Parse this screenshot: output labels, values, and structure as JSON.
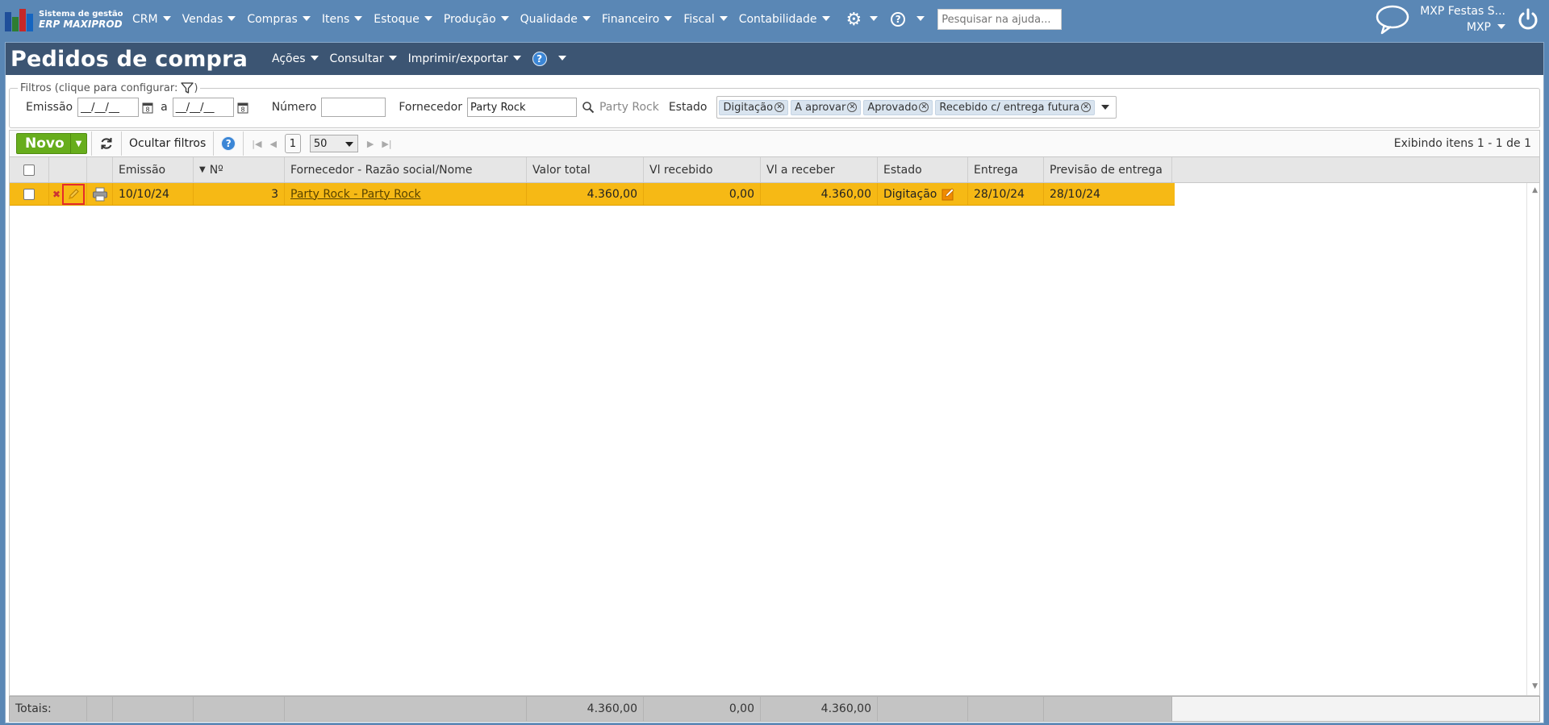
{
  "brand": {
    "line1": "Sistema de gestão",
    "line2": "ERP MAXIPROD"
  },
  "menu": [
    {
      "label": "CRM"
    },
    {
      "label": "Vendas"
    },
    {
      "label": "Compras"
    },
    {
      "label": "Itens"
    },
    {
      "label": "Estoque"
    },
    {
      "label": "Produção"
    },
    {
      "label": "Qualidade"
    },
    {
      "label": "Financeiro"
    },
    {
      "label": "Fiscal"
    },
    {
      "label": "Contabilidade"
    }
  ],
  "help_search": {
    "placeholder": "Pesquisar na ajuda..."
  },
  "user": {
    "company": "MXP Festas S...",
    "account": "MXP"
  },
  "page": {
    "title": "Pedidos de compra",
    "actions": [
      "Ações",
      "Consultar",
      "Imprimir/exportar"
    ]
  },
  "filters": {
    "legend": "Filtros (clique para configurar:",
    "legend_close": ")",
    "emissao_label": "Emissão",
    "date_from": "__/__/__",
    "sep": "a",
    "date_to": "__/__/__",
    "numero_label": "Número",
    "numero_value": "",
    "fornecedor_label": "Fornecedor",
    "fornecedor_value": "Party Rock",
    "fornecedor_name": "Party Rock",
    "estado_label": "Estado",
    "estado_chips": [
      "Digitação",
      "A aprovar",
      "Aprovado",
      "Recebido c/ entrega futura"
    ]
  },
  "toolbar": {
    "novo_label": "Novo",
    "hide_filters_label": "Ocultar filtros",
    "page_number": "1",
    "page_size": "50",
    "range_text": "Exibindo itens 1 - 1 de 1"
  },
  "grid": {
    "columns": [
      "Emissão",
      "Nº",
      "Fornecedor - Razão social/Nome",
      "Valor total",
      "Vl recebido",
      "Vl a receber",
      "Estado",
      "Entrega",
      "Previsão de entrega"
    ],
    "rows": [
      {
        "emissao": "10/10/24",
        "numero": "3",
        "fornecedor": "Party Rock - Party Rock",
        "valor_total": "4.360,00",
        "vl_recebido": "0,00",
        "vl_a_receber": "4.360,00",
        "estado": "Digitação",
        "entrega": "28/10/24",
        "previsao": "28/10/24"
      }
    ],
    "totals": {
      "label": "Totais:",
      "valor_total": "4.360,00",
      "vl_recebido": "0,00",
      "vl_a_receber": "4.360,00"
    }
  },
  "colors": {
    "topbar": "#5a87b5",
    "titlebar": "#3c5573",
    "row_highlight": "#f6b915",
    "novo_button": "#67ad1c"
  }
}
